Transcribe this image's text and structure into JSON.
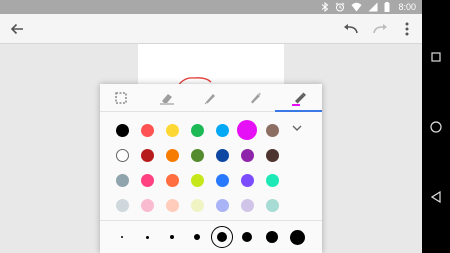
{
  "status_bar": {
    "time": "8:00",
    "icons": [
      "bluetooth-icon",
      "alarm-icon",
      "wifi-icon",
      "signal-icon",
      "battery-icon"
    ]
  },
  "toolbar": {
    "icons": [
      "back-arrow-icon",
      "undo-icon",
      "redo-icon",
      "more-vert-icon"
    ]
  },
  "drawing_tools": {
    "items": [
      "select-tool-icon",
      "eraser-tool-icon",
      "pen-tool-icon",
      "marker-tool-icon",
      "highlighter-tool-icon"
    ],
    "selected": "highlighter-tool-icon"
  },
  "palette": {
    "rows": [
      [
        "#000000",
        "#ff5252",
        "#fdd835",
        "#1db954",
        "#03a9f4",
        "#e510f5",
        "#8d6e63"
      ],
      [
        "#ffffff",
        "#b71c1c",
        "#f57c00",
        "#558b2f",
        "#0d47a1",
        "#8e24aa",
        "#4e342e"
      ],
      [
        "#90a4ae",
        "#ff4081",
        "#ff6e40",
        "#c6e81b",
        "#2979ff",
        "#7c4dff",
        "#1de9b6"
      ],
      [
        "#cfd8dc",
        "#f8bbd0",
        "#ffccbc",
        "#f0f4c3",
        "#a9b4f7",
        "#d1c4e9",
        "#a7dcd5"
      ]
    ],
    "selected_color": "#e510f5",
    "expand_icon": "chevron-down-icon"
  },
  "stroke_sizes": {
    "count": 8,
    "selected_index": 4
  },
  "nav_bar": {
    "icons": [
      "recents-icon",
      "home-icon",
      "back-icon"
    ]
  }
}
